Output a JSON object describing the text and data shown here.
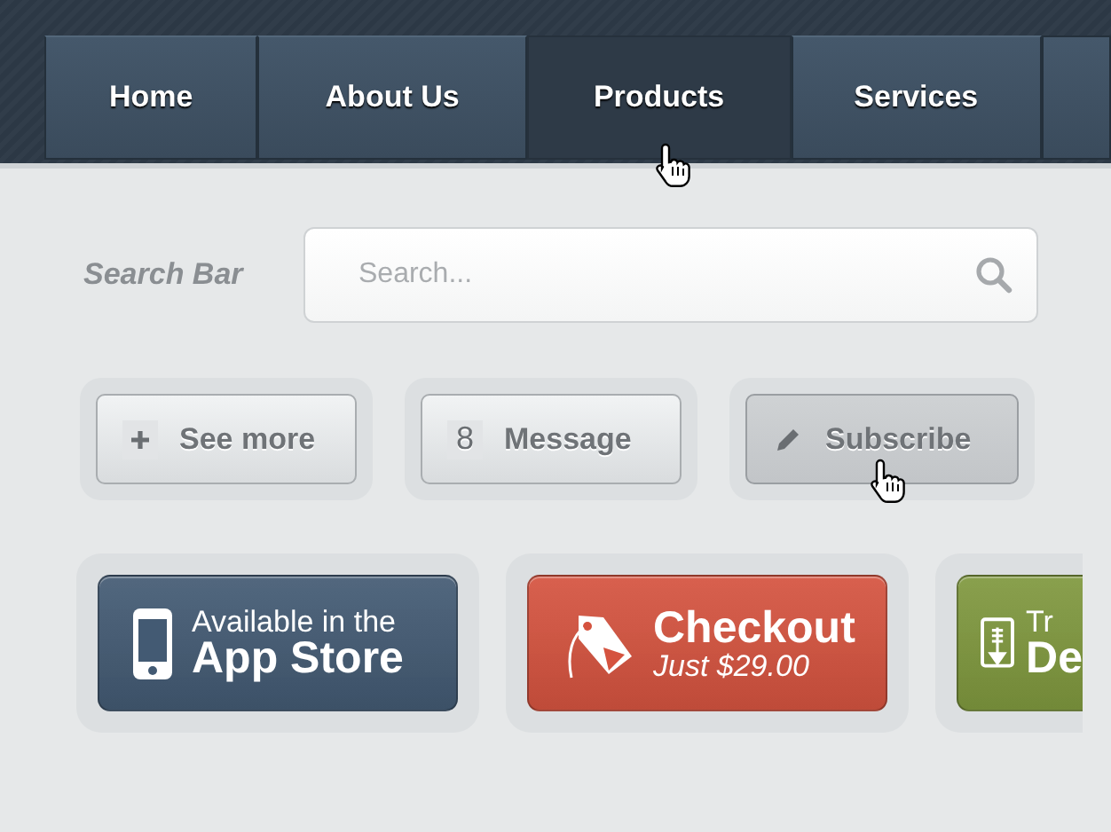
{
  "nav": {
    "tabs": [
      {
        "label": "Home",
        "selected": false
      },
      {
        "label": "About Us",
        "selected": false
      },
      {
        "label": "Products",
        "selected": true
      },
      {
        "label": "Services",
        "selected": false
      }
    ]
  },
  "search": {
    "label": "Search Bar",
    "placeholder": "Search..."
  },
  "small_buttons": [
    {
      "kind": "plus",
      "label": "See more",
      "pressed": false
    },
    {
      "kind": "badge",
      "badge": "8",
      "label": "Message",
      "pressed": false
    },
    {
      "kind": "pencil",
      "label": "Subscribe",
      "pressed": true
    }
  ],
  "large_buttons": [
    {
      "kind": "phone",
      "line_1": "Available in the",
      "line_2": "App Store",
      "color": "#435a73"
    },
    {
      "kind": "tag",
      "line_1": "Checkout",
      "line_2": "Just $29.00",
      "color": "#d5533f"
    },
    {
      "kind": "download",
      "line_1": "Tr",
      "line_2": "De",
      "color": "#7f983e"
    }
  ]
}
